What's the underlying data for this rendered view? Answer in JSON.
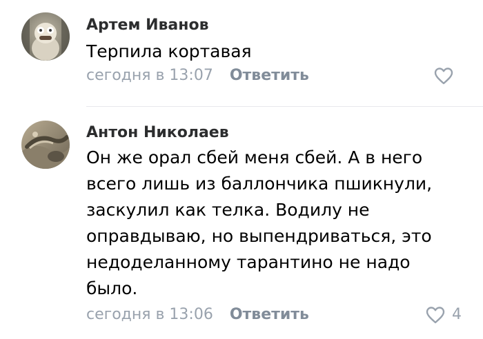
{
  "comments": [
    {
      "author": "Артем Иванов",
      "text": "Терпила кортавая",
      "date": "сегодня в 13:07",
      "reply_label": "Ответить",
      "likes": "",
      "icons": {
        "avatar": "user-avatar-photo",
        "like": "heart-icon"
      }
    },
    {
      "author": "Антон Николаев",
      "text": "Он же орал сбей меня сбей. А в него\nвсего лишь из баллончика пшикнули,\nзаскулил как телка. Водилу не\nоправдываю, но выпендриваться, это\nнедоделанному тарантино не надо\nбыло.",
      "date": "сегодня в 13:06",
      "reply_label": "Ответить",
      "likes": "4",
      "icons": {
        "avatar": "user-avatar-photo",
        "like": "heart-icon"
      }
    }
  ],
  "colors": {
    "author": "#2c2d2e",
    "text": "#000000",
    "meta": "#99a2ad",
    "reply": "#818c99",
    "divider": "#e7e8ec"
  }
}
